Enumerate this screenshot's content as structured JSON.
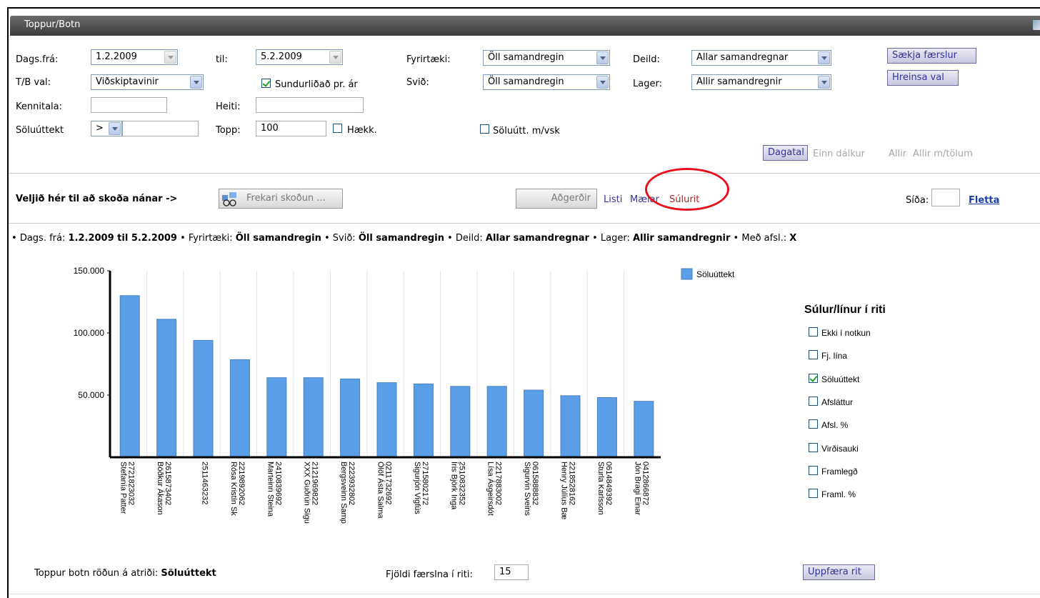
{
  "window": {
    "title": "Toppur/Botn"
  },
  "form": {
    "dags_fra_label": "Dags.frá:",
    "dags_fra_value": "1.2.2009",
    "til_label": "til:",
    "til_value": "5.2.2009",
    "fyrirtaeki_label": "Fyrirtæki:",
    "fyrirtaeki_value": "Öll samandregin",
    "deild_label": "Deild:",
    "deild_value": "Allar samandregnar",
    "tb_label": "T/B val:",
    "tb_value": "Viðskiptavinir",
    "sundurlidad_label": "Sundurliðað pr. ár",
    "svid_label": "Svið:",
    "svid_value": "Öll samandregin",
    "lager_label": "Lager:",
    "lager_value": "Allir samandregnir",
    "kennitala_label": "Kennitala:",
    "kennitala_value": "",
    "heiti_label": "Heiti:",
    "heiti_value": "",
    "soluuttekt_label": "Söluúttekt",
    "soluuttekt_op": ">",
    "soluuttekt_value": "",
    "topp_label": "Topp:",
    "topp_value": "100",
    "haekk_label": "Hækk.",
    "soluutt_vsk_label": "Söluútt. m/vsk"
  },
  "buttons": {
    "saekja": "Sækja færslur",
    "hreinsa": "Hreinsa val",
    "dagatal": "Dagatal",
    "einn_dalkur": "Einn dálkur",
    "allir": "Allir",
    "allir_tolum": "Allir m/tölum"
  },
  "toolbar": {
    "veljid": "Veljið hér til að skoða nánar ->",
    "frekari": "Frekari skoðun ...",
    "adgerdir": "Aðgerðir",
    "listi": "Listi",
    "maelar": "Mælar",
    "sulurit": "Súlurit",
    "sida_label": "Síða:",
    "sida_value": "",
    "fletta": "Fletta"
  },
  "filter_summary": {
    "dags_label": "Dags. frá:",
    "dags_value": "1.2.2009 til 5.2.2009",
    "fyrirtaeki_label": "Fyrirtæki:",
    "fyrirtaeki_value": "Öll samandregin",
    "svid_label": "Svið:",
    "svid_value": "Öll samandregin",
    "deild_label": "Deild:",
    "deild_value": "Allar samandregnar",
    "lager_label": "Lager:",
    "lager_value": "Allir samandregnir",
    "afsl_label": "Með afsl.:",
    "afsl_value": "X"
  },
  "series_panel": {
    "title": "Súlur/línur í riti",
    "items": [
      {
        "label": "Ekki í notkun",
        "checked": false
      },
      {
        "label": "Fj. lína",
        "checked": false
      },
      {
        "label": "Söluúttekt",
        "checked": true
      },
      {
        "label": "Afsláttur",
        "checked": false
      },
      {
        "label": "Afsl. %",
        "checked": false
      },
      {
        "label": "Virðisauki",
        "checked": false
      },
      {
        "label": "Framlegð",
        "checked": false
      },
      {
        "label": "Framl. %",
        "checked": false
      }
    ]
  },
  "footer": {
    "rodun_label": "Toppur botn röðun á atriði:",
    "rodun_value": "Söluúttekt",
    "fjoldi_label": "Fjöldi færslna í riti:",
    "fjoldi_value": "15",
    "uppfaera": "Uppfæra rit"
  },
  "colors": {
    "bar": "#5b9ee8",
    "accent_red": "#e8111b",
    "link": "#333399"
  },
  "chart_data": {
    "type": "bar",
    "categories": [
      "2721823032 Stefanía Patter",
      "2615873402 Böðkur Ákason",
      "2511463232",
      "2219892062 Rósa Kristín Sk",
      "2410839692 Marteinn Steina",
      "2121969822 XXX Guðrún Sigu",
      "2223932802 Bergsveinn Samp",
      "0211732692 Ólöf Ásta Salma",
      "2715802172 Sigurjón Vigfús",
      "2510832352 Íris Björk Inga",
      "2217883002 Lísa Ásgeirsdót",
      "0615888832 Sigurvin Sveins",
      "2218528162 Henry Júlíus Bæ",
      "0614849392 Sturla Karlsson",
      "0412866872 Jón Bragi Einar"
    ],
    "series": [
      {
        "name": "Söluúttekt",
        "values": [
          130000,
          111000,
          94000,
          78500,
          64000,
          64000,
          63000,
          60000,
          59000,
          57000,
          57000,
          54000,
          49500,
          48000,
          45000
        ]
      }
    ],
    "y_ticks": [
      "150.000",
      "100.000",
      "50.000"
    ],
    "ylim": [
      0,
      150000
    ],
    "grid": true,
    "legend": "top-right"
  }
}
